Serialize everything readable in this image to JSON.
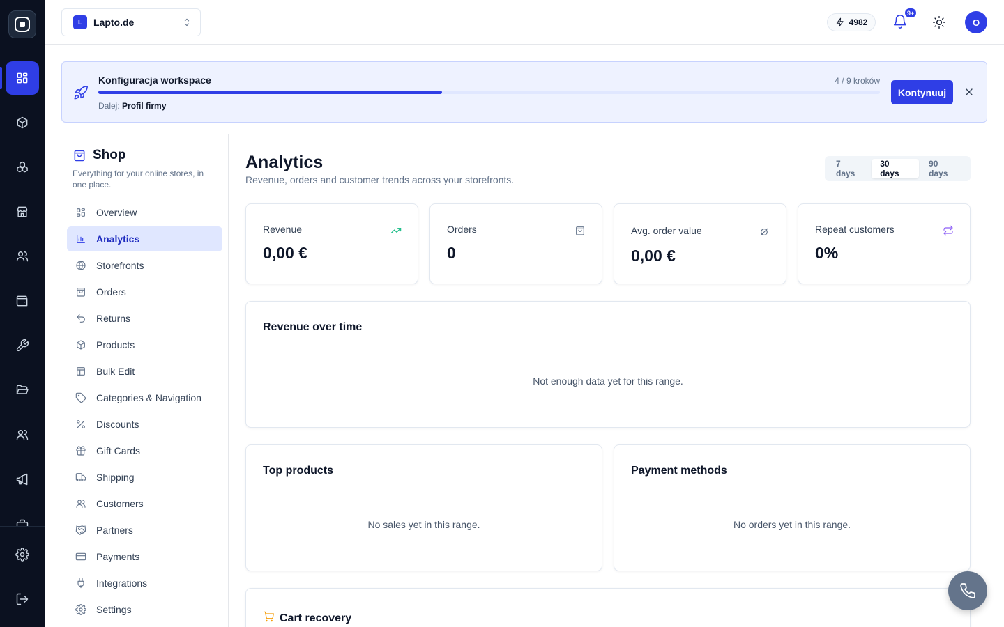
{
  "workspace": {
    "initial": "L",
    "name": "Lapto.de"
  },
  "header": {
    "credits": "4982",
    "notifications": "9+",
    "avatar_initial": "O"
  },
  "rail": {
    "icons": [
      "dashboard-icon",
      "package-icon",
      "modules-icon",
      "store-icon",
      "users-icon",
      "wallet-icon",
      "wrench-icon",
      "folder-icon",
      "team-icon",
      "megaphone-icon",
      "briefcase-icon",
      "settings-icon",
      "logout-icon"
    ],
    "active": "dashboard-icon"
  },
  "banner": {
    "title": "Konfiguracja workspace",
    "steps": "4 / 9 kroków",
    "progress": 0.44,
    "next_label": "Dalej:",
    "next_value": "Profil firmy",
    "cta": "Kontynuuj"
  },
  "shop": {
    "title": "Shop",
    "description": "Everything for your online stores, in one place.",
    "nav": [
      {
        "label": "Overview",
        "icon": "layout-icon"
      },
      {
        "label": "Analytics",
        "icon": "bar-chart-icon",
        "active": true
      },
      {
        "label": "Storefronts",
        "icon": "globe-icon"
      },
      {
        "label": "Orders",
        "icon": "shopping-bag-icon"
      },
      {
        "label": "Returns",
        "icon": "undo-icon"
      },
      {
        "label": "Products",
        "icon": "box-icon"
      },
      {
        "label": "Bulk Edit",
        "icon": "table-icon"
      },
      {
        "label": "Categories & Navigation",
        "icon": "tag-icon"
      },
      {
        "label": "Discounts",
        "icon": "percent-icon"
      },
      {
        "label": "Gift Cards",
        "icon": "gift-icon"
      },
      {
        "label": "Shipping",
        "icon": "truck-icon"
      },
      {
        "label": "Customers",
        "icon": "users-icon"
      },
      {
        "label": "Partners",
        "icon": "handshake-icon"
      },
      {
        "label": "Payments",
        "icon": "credit-card-icon"
      },
      {
        "label": "Integrations",
        "icon": "plug-icon"
      },
      {
        "label": "Settings",
        "icon": "gear-icon"
      }
    ]
  },
  "page": {
    "title": "Analytics",
    "subtitle": "Revenue, orders and customer trends across your storefronts.",
    "ranges": [
      "7 days",
      "30 days",
      "90 days"
    ],
    "selected_range": "30 days"
  },
  "kpis": [
    {
      "label": "Revenue",
      "value": "0,00 €",
      "icon": "trending-up-icon",
      "color": "#10b981"
    },
    {
      "label": "Orders",
      "value": "0",
      "icon": "shopping-bag-icon",
      "color": "#64748b"
    },
    {
      "label": "Avg. order value",
      "value": "0,00 €",
      "icon": "average-icon",
      "color": "#64748b"
    },
    {
      "label": "Repeat customers",
      "value": "0%",
      "icon": "repeat-icon",
      "color": "#8b5cf6"
    }
  ],
  "revenue_card": {
    "title": "Revenue over time",
    "empty": "Not enough data yet for this range."
  },
  "top_products": {
    "title": "Top products",
    "empty": "No sales yet in this range."
  },
  "payment_methods": {
    "title": "Payment methods",
    "empty": "No orders yet in this range."
  },
  "cart_recovery": {
    "title": "Cart recovery",
    "icon_color": "#f59e0b"
  },
  "colors": {
    "accent": "#2f3ee6",
    "rail": "#0b1120"
  }
}
